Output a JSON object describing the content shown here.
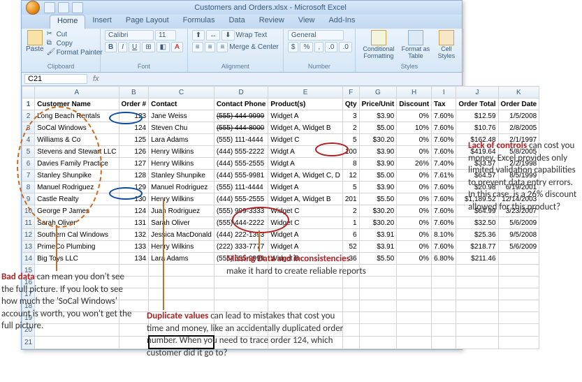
{
  "window": {
    "title": "Customers and Orders.xlsx - Microsoft Excel"
  },
  "tabs": {
    "home": "Home",
    "insert": "Insert",
    "page_layout": "Page Layout",
    "formulas": "Formulas",
    "data": "Data",
    "review": "Review",
    "view": "View",
    "addins": "Add-Ins"
  },
  "ribbon": {
    "clipboard": {
      "label": "Clipboard",
      "paste": "Paste",
      "cut": "Cut",
      "copy": "Copy",
      "format_painter": "Format Painter"
    },
    "font": {
      "label": "Font",
      "family": "Calibri",
      "size": "11"
    },
    "alignment": {
      "label": "Alignment",
      "wrap": "Wrap Text",
      "merge": "Merge & Center"
    },
    "number": {
      "label": "Number",
      "format": "General"
    },
    "styles": {
      "label": "Styles",
      "cond": "Conditional Formatting",
      "table": "Format as Table",
      "cell": "Cell Styles"
    }
  },
  "namebox": "C21",
  "columns": [
    "A",
    "B",
    "C",
    "D",
    "E",
    "F",
    "G",
    "H",
    "I",
    "J",
    "K"
  ],
  "headers": {
    "A": "Customer Name",
    "B": "Order #",
    "C": "Contact",
    "D": "Contact Phone",
    "E": "Product(s)",
    "F": "Qty",
    "G": "Price/Unit",
    "H": "Discount",
    "I": "Tax",
    "J": "Order Total",
    "K": "Order Date"
  },
  "rows": [
    {
      "n": 2,
      "A": "Long Beach Rentals",
      "B": "123",
      "C": "Jane Weiss",
      "D": "(555) 444-9999",
      "Dstrike": true,
      "E": "Widget A",
      "F": "3",
      "G": "$3.90",
      "H": "0%",
      "I": "7.60%",
      "J": "$12.59",
      "K": "1/5/2008"
    },
    {
      "n": 3,
      "A": "SoCal Windows",
      "B": "124",
      "C": "Steven Chu",
      "D": "(555) 444-8000",
      "Dstrike": true,
      "E": "Widget A, Widget B",
      "F": "2",
      "G": "$5.00",
      "H": "10%",
      "I": "7.60%",
      "J": "$10.76",
      "K": "2/8/2005"
    },
    {
      "n": 4,
      "A": "Williams & Co",
      "B": "125",
      "C": "Lara Adams",
      "D": "(555) 111-4444",
      "E": "Widget C",
      "F": "5",
      "G": "$30.20",
      "H": "0%",
      "I": "7.60%",
      "J": "$162.48",
      "K": "2/1/1997"
    },
    {
      "n": 5,
      "A": "Stevens and Stewart LLC",
      "B": "126",
      "C": "Henry Wilkins",
      "D": "(444) 555-2222",
      "E": "Widgt A",
      "F": "100",
      "G": "$3.90",
      "H": "0%",
      "I": "7.60%",
      "J": "$419.64",
      "K": "5/8/2005"
    },
    {
      "n": 6,
      "A": "Davies Family Practice",
      "B": "127",
      "C": "Henry Wilkins",
      "D": "(444) 555-2555",
      "E": "Widgt A",
      "F": "8",
      "G": "$3.90",
      "H": "26%",
      "I": "7.40%",
      "J": "$33.57",
      "K": "2/2/1998"
    },
    {
      "n": 7,
      "A": "Stanley Shunpike",
      "B": "128",
      "C": "Stanley Shunpike",
      "D": "(444) 555-9981",
      "E": "Widget A, Widget C, D",
      "F": "12",
      "G": "$5.00",
      "H": "0%",
      "I": "7.61%",
      "J": "$64.57",
      "K": "8/5/1999"
    },
    {
      "n": 8,
      "A": "Manuel Rodriguez",
      "B": "129",
      "C": "Manuel Rodriguez",
      "D": "(555) 111-4444",
      "E": "Widget A",
      "F": "5",
      "G": "$3.90",
      "H": "0%",
      "I": "7.60%",
      "J": "$20.98",
      "K": "6/19/2001"
    },
    {
      "n": 9,
      "A": "Castle Realty",
      "B": "130",
      "C": "Henry Wilkins",
      "D": "(444) 555-2555",
      "E": "Widget A, Widget B",
      "F": "201",
      "G": "$5.50",
      "H": "0%",
      "I": "7.60%",
      "J": "$1,189.52",
      "K": "12/14/2003"
    },
    {
      "n": 10,
      "A": "George P James",
      "B": "124",
      "C": "Juan Rodriguez",
      "D": "(555) 999-3333",
      "E": "Widget C",
      "F": "2",
      "G": "$30.20",
      "H": "0%",
      "I": "7.60%",
      "J": "$64.99",
      "K": "3/23/2007"
    },
    {
      "n": 11,
      "A": "Sarah Oliver",
      "B": "131",
      "C": "Sarah Oliver",
      "D": "(555) 444-2222",
      "E": "Widget C",
      "F": "1",
      "G": "$30.20",
      "H": "0%",
      "I": "7.60%",
      "J": "$32.50",
      "K": "5/6/2009"
    },
    {
      "n": 12,
      "A": "Southern Cal Windows",
      "B": "132",
      "C": "Jessica MacDonald",
      "D": "(444) 222-1393",
      "E": "Widget A",
      "F": "6",
      "G": "$3.91",
      "H": "0%",
      "I": "8.10%",
      "J": "$25.36",
      "K": "9/5/2008"
    },
    {
      "n": 13,
      "A": "PrimeCo Plumbing",
      "B": "133",
      "C": "Henry Wilkins",
      "D": "(222) 333-7777",
      "E": "Widget A",
      "F": "52",
      "G": "$3.91",
      "H": "0%",
      "I": "7.60%",
      "J": "$218.77",
      "K": "5/6/2009"
    },
    {
      "n": 14,
      "A": "Big Toys LLC",
      "B": "134",
      "C": "Lara Adams",
      "D": "(555) 555-9999",
      "E": "Widget B",
      "F": "36",
      "G": "$5.50",
      "H": "0%",
      "I": "6.80%",
      "J": "$211.46",
      "K": ""
    }
  ],
  "annotations": {
    "bad_data": {
      "head": "Bad data",
      "body": " can mean you don't see the full picture. If you look to see how much the 'SoCal Windows' account is worth, you won't get the full picture."
    },
    "duplicates": {
      "head": "Duplicate values",
      "body": " can lead to mistakes that cost you time and money, like an accidentally duplicated order number. When you need to trace order 124, which customer did it go to?"
    },
    "missing": {
      "head": "Missing Data and inconsistencies",
      "body": "make it hard to create reliable reports"
    },
    "controls": {
      "head": "Lack of controls",
      "body": " can cost you money.  Excel provides only limited validation capabilities to prevent data entry errors.   In this case, is a 26% discount allowed for this product?"
    }
  }
}
